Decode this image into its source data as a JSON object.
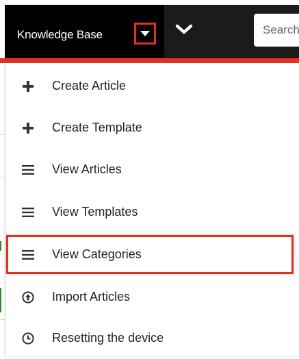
{
  "topbar": {
    "module_label": "Knowledge Base",
    "search_placeholder": "Search"
  },
  "menu": {
    "items": [
      {
        "label": "Create Article",
        "icon": "plus-icon"
      },
      {
        "label": "Create Template",
        "icon": "plus-icon"
      },
      {
        "label": "View Articles",
        "icon": "list-icon"
      },
      {
        "label": "View Templates",
        "icon": "list-icon"
      },
      {
        "label": "View Categories",
        "icon": "list-icon",
        "highlighted": true
      },
      {
        "label": "Import Articles",
        "icon": "upload-circle-icon"
      },
      {
        "label": "Resetting the device",
        "icon": "clock-icon"
      }
    ]
  },
  "colors": {
    "accent": "#e4311f",
    "topbar_bg": "#000000",
    "topbar_bg_secondary": "#1b1b1b",
    "text": "#222222"
  }
}
